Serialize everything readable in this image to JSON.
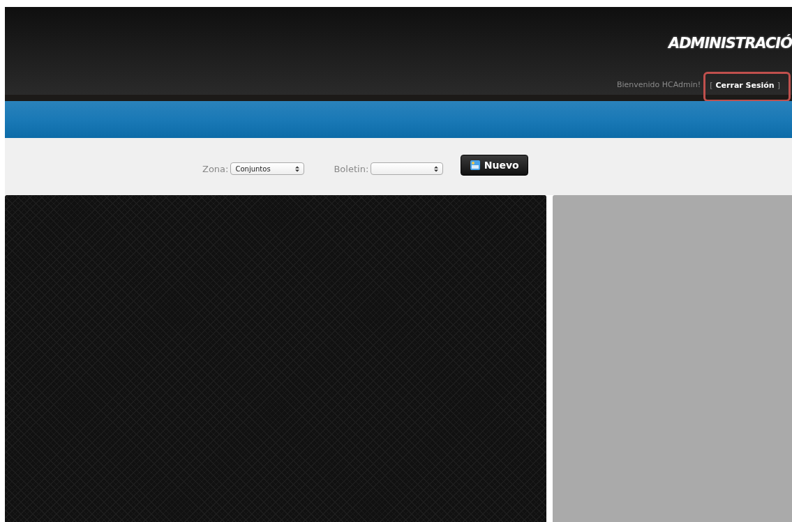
{
  "header": {
    "title": "ADMINISTRACIÓ",
    "welcome": "Bienvenido HCAdmin!",
    "logout": {
      "open": "[",
      "label": "Cerrar Sesión",
      "close": "]",
      "highlighted": true
    }
  },
  "toolbar": {
    "fields": [
      {
        "label": "Zona:",
        "value": "Conjuntos"
      },
      {
        "label": "Boletin:"
      }
    ],
    "button": "Nuevo"
  }
}
